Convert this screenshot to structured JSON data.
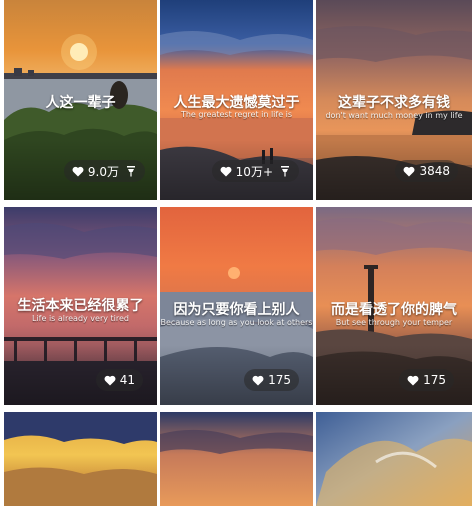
{
  "tiles": [
    {
      "caption": "人这一辈子",
      "subtitle": "",
      "likes": "9.0万",
      "pinned": true
    },
    {
      "caption": "人生最大遗憾莫过于",
      "subtitle": "The greatest regret in life is",
      "likes": "10万+",
      "pinned": true
    },
    {
      "caption": "这辈子不求多有钱",
      "subtitle": "don't want much money in my life",
      "likes": "3848",
      "pinned": false
    },
    {
      "caption": "生活本来已经很累了",
      "subtitle": "Life is already very tired",
      "likes": "41",
      "pinned": false
    },
    {
      "caption": "因为只要你看上别人",
      "subtitle": "Because as long as you look at others",
      "likes": "175",
      "pinned": false
    },
    {
      "caption": "而是看透了你的脾气",
      "subtitle": "But see through your temper",
      "likes": "175",
      "pinned": false
    },
    {
      "caption": "",
      "subtitle": "",
      "likes": "",
      "pinned": false
    },
    {
      "caption": "",
      "subtitle": "",
      "likes": "",
      "pinned": false
    },
    {
      "caption": "",
      "subtitle": "",
      "likes": "",
      "pinned": false
    }
  ],
  "icons": {
    "like": "heart-icon",
    "pin": "pin-icon"
  }
}
